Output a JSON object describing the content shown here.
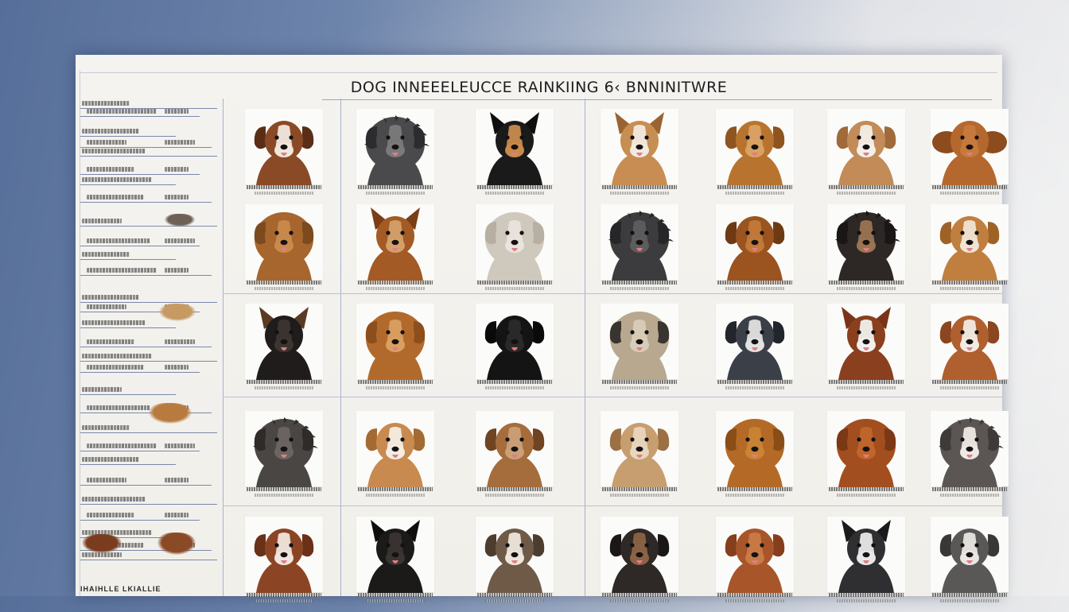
{
  "board": {
    "title": "DOG  INNEEELEUCCE  RAINKIING  6‹  BNNINITWRE",
    "footer": "IHAIHLLE  LKIALLIE"
  },
  "colors": {
    "background_left": "#566f9a",
    "board": "#f2f0eb",
    "grid_lines": "#a6b1cb",
    "sidebar_lines": "#7a88aa"
  },
  "dogs": [
    {
      "fur": "#8a4a26",
      "face": "#f1e7dc",
      "ear": "#5a2e16",
      "type": "floppy"
    },
    {
      "fur": "#4a4a4c",
      "face": "#7a7a7a",
      "ear": "#2c2c2e",
      "type": "shaggy"
    },
    {
      "fur": "#1b1a1a",
      "face": "#c98b4c",
      "ear": "#0e0e0e",
      "type": "pointy"
    },
    {
      "fur": "#c78d52",
      "face": "#f3eadf",
      "ear": "#9a6432",
      "type": "pointy"
    },
    {
      "fur": "#b8742f",
      "face": "#d9a264",
      "ear": "#8f5520",
      "type": "floppy"
    },
    {
      "fur": "#c28b57",
      "face": "#f4efe8",
      "ear": "#a06a3b",
      "type": "floppy"
    },
    {
      "fur": "#b5682d",
      "face": "#c77a3b",
      "ear": "#8d4c1d",
      "type": "wide"
    },
    {
      "fur": "#a6662e",
      "face": "#c98a4c",
      "ear": "#7c4a1f",
      "type": "fluffy"
    },
    {
      "fur": "#a35a24",
      "face": "#d4a06a",
      "ear": "#7a3e15",
      "type": "pointy"
    },
    {
      "fur": "#cfc8bd",
      "face": "#e9e4dc",
      "ear": "#b7afa2",
      "type": "fluffy"
    },
    {
      "fur": "#3c3c3e",
      "face": "#5d5d5f",
      "ear": "#262628",
      "type": "shaggy"
    },
    {
      "fur": "#9b531f",
      "face": "#c27a3a",
      "ear": "#6e3a14",
      "type": "floppy"
    },
    {
      "fur": "#2d2826",
      "face": "#9b7452",
      "ear": "#1a1615",
      "type": "shaggy"
    },
    {
      "fur": "#c07f3f",
      "face": "#f0e4d4",
      "ear": "#9e6227",
      "type": "floppy"
    },
    {
      "fur": "#1f1c1b",
      "face": "#3c3532",
      "ear": "#5a3a24",
      "type": "pointy"
    },
    {
      "fur": "#b26a2c",
      "face": "#d9a062",
      "ear": "#8c4e1c",
      "type": "fluffy"
    },
    {
      "fur": "#141414",
      "face": "#2a2a2a",
      "ear": "#0a0a0a",
      "type": "floppy"
    },
    {
      "fur": "#b8a88f",
      "face": "#d8ccb8",
      "ear": "#3a3430",
      "type": "fluffy"
    },
    {
      "fur": "#3b3f47",
      "face": "#e2e2e2",
      "ear": "#22252b",
      "type": "floppy"
    },
    {
      "fur": "#8a3f1e",
      "face": "#f2f0ee",
      "ear": "#7a3318",
      "type": "pointy"
    },
    {
      "fur": "#b05f2e",
      "face": "#f2ebe3",
      "ear": "#8a4521",
      "type": "floppy"
    },
    {
      "fur": "#4a4644",
      "face": "#6b6562",
      "ear": "#2f2b29",
      "type": "shaggy"
    },
    {
      "fur": "#c88a4e",
      "face": "#f4ede3",
      "ear": "#a36a33",
      "type": "floppy"
    },
    {
      "fur": "#a56c3c",
      "face": "#caa077",
      "ear": "#6f4422",
      "type": "floppy"
    },
    {
      "fur": "#c79e70",
      "face": "#e8d6bd",
      "ear": "#9b7144",
      "type": "floppy"
    },
    {
      "fur": "#b46a26",
      "face": "#c98435",
      "ear": "#8a4d18",
      "type": "fluffy"
    },
    {
      "fur": "#a34e1f",
      "face": "#c0662c",
      "ear": "#7b3814",
      "type": "fluffy"
    },
    {
      "fur": "#5b5654",
      "face": "#efe9e3",
      "ear": "#3e3a38",
      "type": "shaggy"
    },
    {
      "fur": "#8c4524",
      "face": "#f0e6dc",
      "ear": "#6a3018",
      "type": "floppy"
    },
    {
      "fur": "#1c1a19",
      "face": "#3a3532",
      "ear": "#0f0e0d",
      "type": "pointy"
    },
    {
      "fur": "#6f5a48",
      "face": "#ede6dc",
      "ear": "#4d3d2f",
      "type": "floppy"
    },
    {
      "fur": "#2e2826",
      "face": "#8a6444",
      "ear": "#1b1716",
      "type": "floppy"
    },
    {
      "fur": "#a8552a",
      "face": "#c97b45",
      "ear": "#853f1c",
      "type": "floppy"
    },
    {
      "fur": "#2f2f31",
      "face": "#e8e8e8",
      "ear": "#1a1a1b",
      "type": "pointy"
    },
    {
      "fur": "#5a5856",
      "face": "#e9e6e2",
      "ear": "#3a3837",
      "type": "floppy"
    }
  ]
}
